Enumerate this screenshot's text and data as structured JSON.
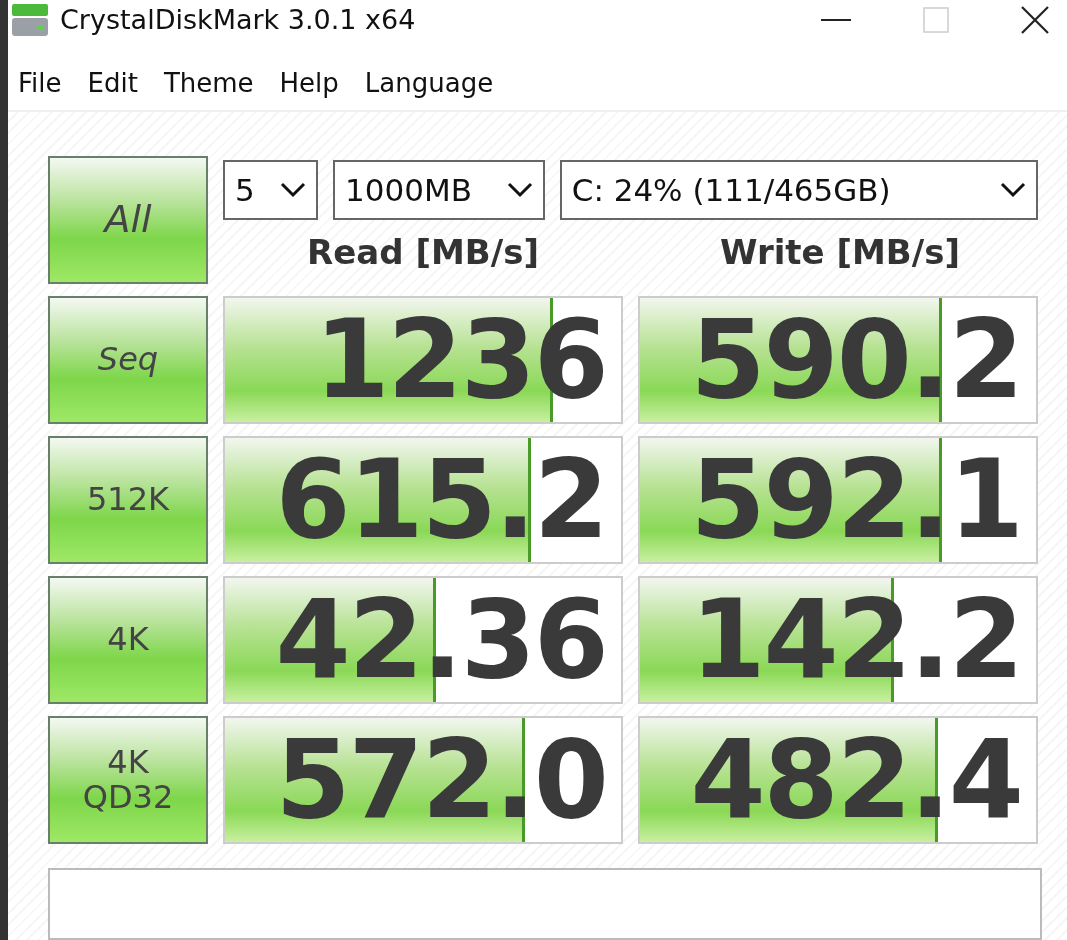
{
  "window": {
    "title": "CrystalDiskMark 3.0.1 x64"
  },
  "menu": [
    "File",
    "Edit",
    "Theme",
    "Help",
    "Language"
  ],
  "all_button": "All",
  "dropdowns": [
    {
      "kind": "count",
      "value": "5"
    },
    {
      "kind": "size",
      "value": "1000MB"
    },
    {
      "kind": "drive",
      "value": "C: 24% (111/465GB)"
    }
  ],
  "headers": [
    "Read [MB/s]",
    "Write [MB/s]"
  ],
  "rows": [
    {
      "label": "Seq",
      "read": {
        "value": "1236",
        "level": 0.82
      },
      "write": {
        "value": "590.2",
        "level": 0.755
      }
    },
    {
      "label": "512K",
      "read": {
        "value": "615.2",
        "level": 0.765
      },
      "write": {
        "value": "592.1",
        "level": 0.755
      }
    },
    {
      "label": "4K",
      "read": {
        "value": "42.36",
        "level": 0.525
      },
      "write": {
        "value": "142.2",
        "level": 0.635
      }
    },
    {
      "label": "4K\nQD32",
      "read": {
        "value": "572.0",
        "level": 0.75
      },
      "write": {
        "value": "482.4",
        "level": 0.745
      }
    }
  ]
}
